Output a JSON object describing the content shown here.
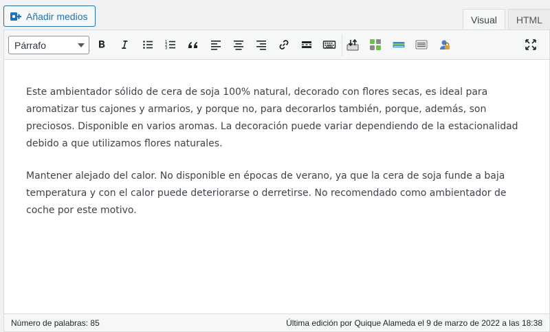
{
  "add_media": {
    "label": "Añadir medios",
    "icon": "add-media-icon"
  },
  "tabs": [
    {
      "label": "Visual",
      "active": true
    },
    {
      "label": "HTML",
      "active": false
    }
  ],
  "toolbar": {
    "format_select": "Párrafo",
    "buttons": [
      {
        "name": "bold",
        "icon": "bold-icon"
      },
      {
        "name": "italic",
        "icon": "italic-icon"
      },
      {
        "name": "bullet-list",
        "icon": "bullet-list-icon"
      },
      {
        "name": "numbered-list",
        "icon": "numbered-list-icon"
      },
      {
        "name": "blockquote",
        "icon": "quote-icon"
      },
      {
        "name": "align-left",
        "icon": "align-left-icon"
      },
      {
        "name": "align-center",
        "icon": "align-center-icon"
      },
      {
        "name": "align-right",
        "icon": "align-right-icon"
      },
      {
        "name": "insert-link",
        "icon": "link-icon"
      },
      {
        "name": "insert-more",
        "icon": "read-more-icon"
      },
      {
        "name": "toolbar-toggle",
        "icon": "keyboard-icon"
      },
      {
        "name": "plugin-1",
        "icon": "upload-icon"
      },
      {
        "name": "plugin-2",
        "icon": "puzzle-icon"
      },
      {
        "name": "plugin-3",
        "icon": "card-icon"
      },
      {
        "name": "plugin-4",
        "icon": "list-box-icon"
      },
      {
        "name": "plugin-5",
        "icon": "lock-user-icon"
      },
      {
        "name": "fullscreen",
        "icon": "fullscreen-icon"
      }
    ]
  },
  "content": {
    "paragraphs": [
      "Este ambientador sólido de cera de soja 100% natural, decorado con flores secas, es ideal para aromatizar tus cajones y armarios, y porque no, para decorarlos también, porque, además, son preciosos. Disponible en varios aromas. La decoración puede variar dependiendo de la estacionalidad debido a que utilizamos flores naturales.",
      "Mantener alejado del calor. No disponible en épocas de verano, ya que la cera de soja funde a baja temperatura y con el calor puede deteriorarse o derretirse. No recomendado como ambientador de coche por este motivo."
    ]
  },
  "status": {
    "word_count": "Número de palabras: 85",
    "last_edit": "Última edición por Quique Alameda el 9 de marzo de 2022 a las 18:38"
  },
  "colors": {
    "accent": "#2271b1",
    "text": "#3c434a",
    "border": "#dcdcde"
  }
}
